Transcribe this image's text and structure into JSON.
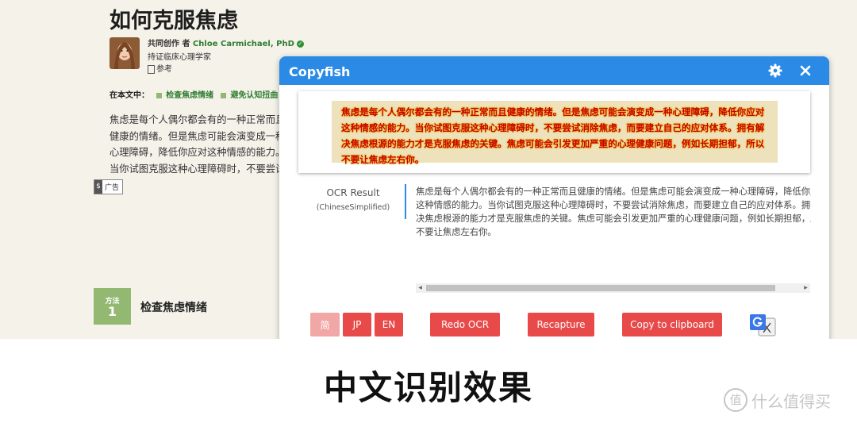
{
  "article": {
    "title": "如何克服焦虑",
    "coauthor_prefix": "共同创作 者 ",
    "author_name": "Chloe Carmichael, PhD",
    "author_role": "持证临床心理学家",
    "references_label": "参考",
    "toc_label": "在本文中：",
    "toc_items": [
      "检查焦虑情绪",
      "避免认知扭曲"
    ],
    "intro_text": "焦虑是每个人偶尔都会有的一种正常而且健康的情绪。但是焦虑可能会演变成一种心理障碍，降低你应对这种情感的能力。当你试图克服这种心理障碍时，不要尝试消除焦虑，而要建立自己的应对体系。拥有解决焦虑根源的能力才是克服焦虑的关键。焦虑可能会引发更加严重的心理健康问题，例如长期抑郁，所以不要让焦虑左右你。",
    "ad_icon": "$",
    "ad_label": "广告",
    "method_word": "方法",
    "method_number": "1",
    "method_title": "检查焦虑情绪"
  },
  "copyfish": {
    "title": "Copyfish",
    "captured_text": "焦虑是每个人偶尔都会有的一种正常而且健康的情绪。但是焦虑可能会演变成一种心理障碍，降低你应对这种情感的能力。当你试图克服这种心理障碍时，不要尝试消除焦虑，而要建立自己的应对体系。拥有解决焦虑根源的能力才是克服焦虑的关键。焦虑可能会引发更加严重的心理健康问题，例如长期担郁，所以不要让焦虑左右你。",
    "ocr_label": "OCR Result",
    "ocr_language": "(ChineseSimplified)",
    "ocr_result": "焦虑是每个人偶尔都会有的一种正常而且健康的情绪。但是焦虑可能会演变成一种心理障碍，降低你应对这种情感的能力。当你试图克服这种心理障碍时，不要尝试消除焦虑，而要建立自己的应对体系。拥有解决焦虑根源的能力才是克服焦虑的关键。焦虑可能会引发更加严重的心理健康问题，例如长期担郁，所以不要让焦虑左右你。",
    "scroll_left": "◀",
    "scroll_right": "▶",
    "buttons": {
      "cn": "简",
      "jp": "JP",
      "en": "EN",
      "redo": "Redo OCR",
      "recapture": "Recapture",
      "copy": "Copy to clipboard"
    }
  },
  "caption": "中文识别效果",
  "watermark": {
    "icon": "值",
    "text": "什么值得买"
  }
}
